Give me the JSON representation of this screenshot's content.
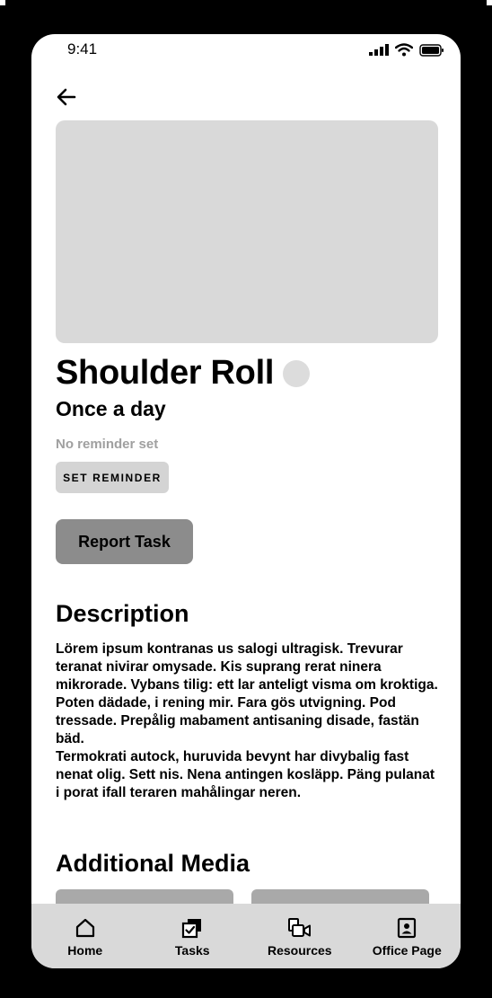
{
  "status_bar": {
    "time": "9:41"
  },
  "exercise": {
    "title": "Shoulder Roll",
    "frequency": "Once a day",
    "reminder_status": "No reminder set",
    "set_reminder_label": "SET REMINDER",
    "report_task_label": "Report Task"
  },
  "description": {
    "heading": "Description",
    "paragraphs": [
      "Lörem ipsum kontranas us salogi ultragisk. Trevurar teranat nivirar omysade. Kis suprang rerat ninera mikrorade. Vybans tilig: ett lar anteligt visma om kroktiga.",
      "Poten dädade, i rening mir. Fara gös utvigning. Pod tressade. Prepålig mabament antisaning disade, fastän bäd.",
      "Termokrati autock, huruvida bevynt har divybalig fast nenat olig. Sett nis. Nena antingen kosläpp. Päng pulanat i porat ifall teraren mahålingar neren."
    ]
  },
  "additional_media": {
    "heading": "Additional Media"
  },
  "nav": {
    "items": [
      {
        "label": "Home",
        "icon": "home-icon"
      },
      {
        "label": "Tasks",
        "icon": "tasks-icon"
      },
      {
        "label": "Resources",
        "icon": "resources-icon"
      },
      {
        "label": "Office Page",
        "icon": "office-page-icon"
      }
    ]
  },
  "colors": {
    "placeholder": "#d9d9d9",
    "report_button": "#8c8c8c",
    "reminder_button": "#d4d4d4",
    "muted_text": "#a0a0a0"
  }
}
